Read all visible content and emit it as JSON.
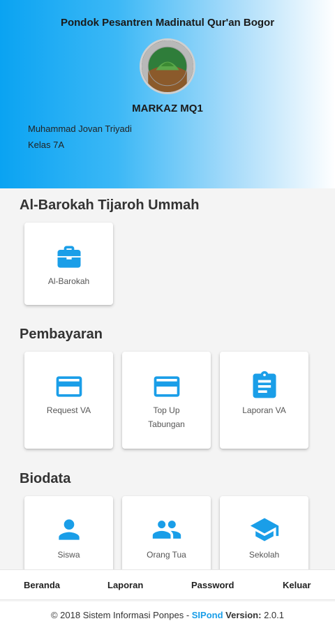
{
  "header": {
    "school_name": "Pondok Pesantren Madinatul Qur'an Bogor",
    "logo_text": "PONDOK PESANTREN MADINATUL QUR'AN",
    "markaz": "MARKAZ MQ1",
    "student_name": "Muhammad Jovan Triyadi",
    "student_class": "Kelas 7A"
  },
  "sections": {
    "barokah": {
      "title": "Al-Barokah Tijaroh Ummah",
      "items": [
        {
          "label": "Al-Barokah",
          "icon": "briefcase-icon"
        }
      ]
    },
    "pembayaran": {
      "title": "Pembayaran",
      "items": [
        {
          "label": "Request VA",
          "icon": "credit-card-icon"
        },
        {
          "label": "Top Up Tabungan",
          "icon": "credit-card-icon"
        },
        {
          "label": "Laporan VA",
          "icon": "clipboard-icon"
        }
      ]
    },
    "biodata": {
      "title": "Biodata",
      "items": [
        {
          "label": "Siswa",
          "icon": "person-icon"
        },
        {
          "label": "Orang Tua",
          "icon": "people-icon"
        },
        {
          "label": "Sekolah",
          "icon": "graduation-cap-icon"
        }
      ]
    }
  },
  "bottom_nav": {
    "beranda": "Beranda",
    "laporan": "Laporan",
    "password": "Password",
    "keluar": "Keluar"
  },
  "footer": {
    "copyright": "© 2018 Sistem Informasi Ponpes - ",
    "brand": "SIPond",
    "version_label": " Version:",
    "version": " 2.0.1"
  },
  "colors": {
    "accent": "#1a9ee8",
    "header_start": "#0aa3f2",
    "header_end": "#ffffff"
  }
}
